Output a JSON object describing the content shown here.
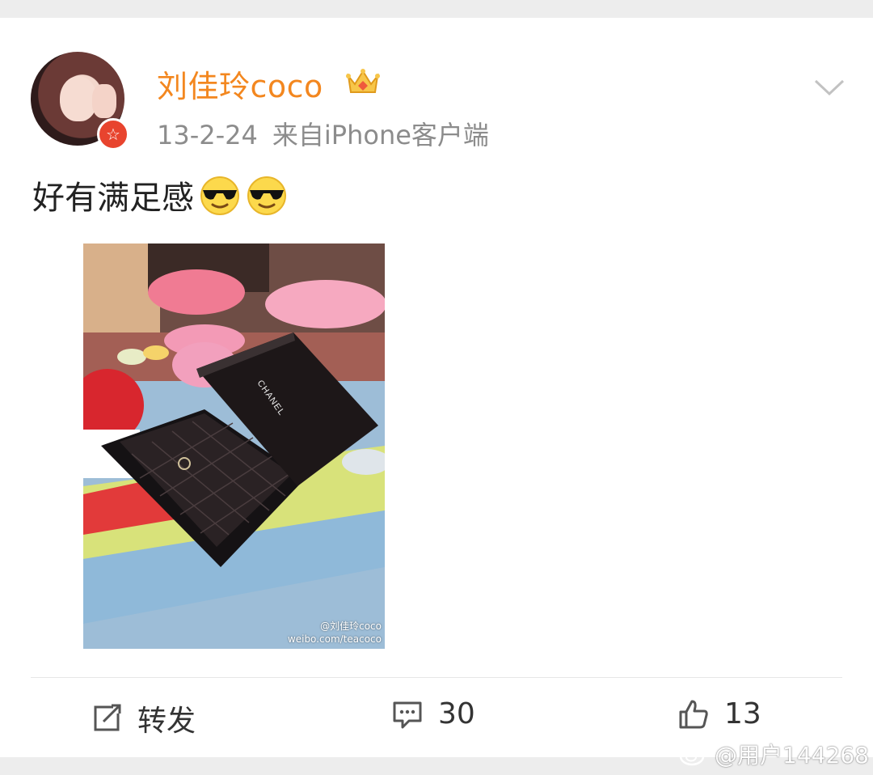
{
  "post": {
    "username": "刘佳玲coco",
    "date": "13-2-24",
    "source": "来自iPhone客户端",
    "text": "好有满足感",
    "image_watermark_user": "@刘佳玲coco",
    "image_watermark_url": "weibo.com/teacoco"
  },
  "icons": {
    "verified_badge": "orange-star-badge-icon",
    "crown": "crown-icon",
    "more": "chevron-down-icon",
    "emoji": "sunglasses-emoji-icon",
    "repost": "repost-icon",
    "comment": "comment-icon",
    "like": "thumbs-up-icon"
  },
  "actions": {
    "repost_label": "转发",
    "comment_count": "30",
    "like_count": "13"
  },
  "watermark": {
    "text": "@用户144268"
  },
  "colors": {
    "username": "#f3871f",
    "meta": "#8c8c8c",
    "badge": "#e8442e"
  }
}
